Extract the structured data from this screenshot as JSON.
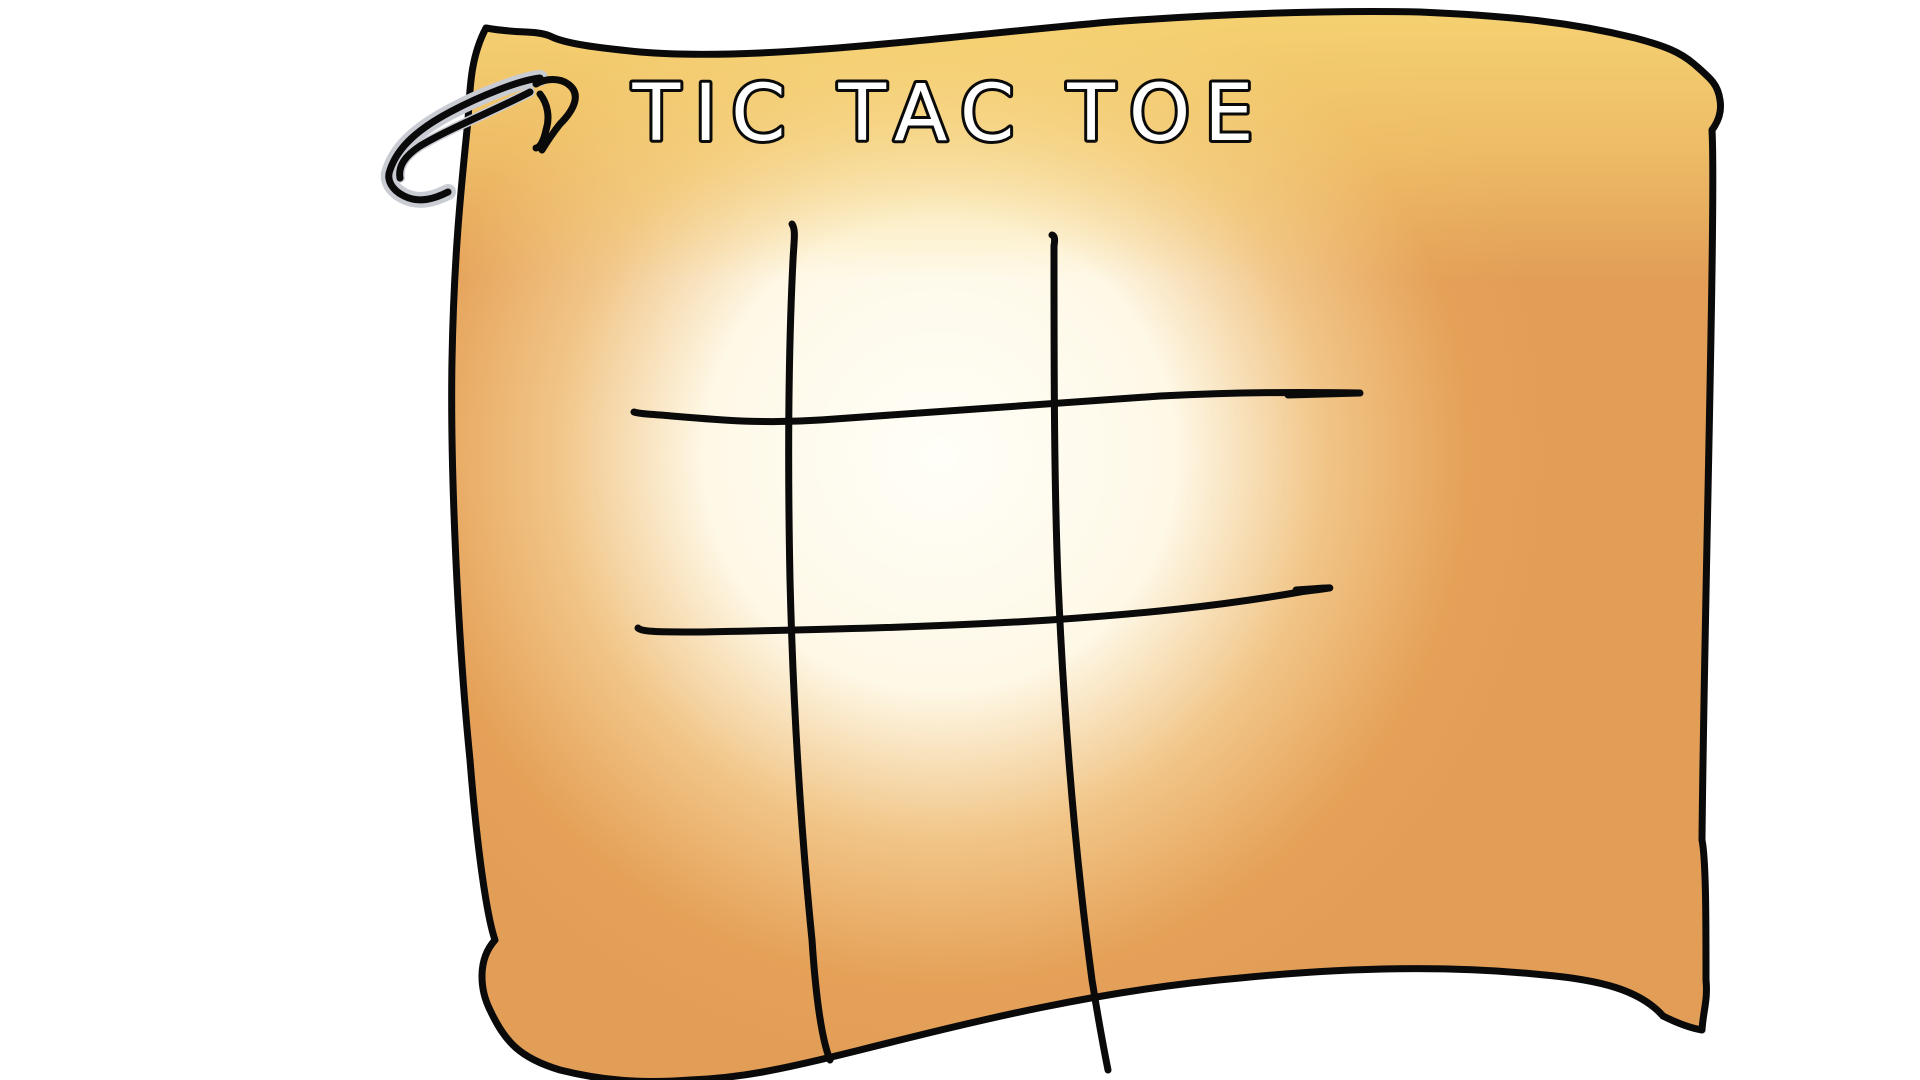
{
  "game": {
    "title": "TIC TAC TOE",
    "cells": [
      "",
      "",
      "",
      "",
      "",
      "",
      "",
      "",
      ""
    ]
  },
  "colors": {
    "paper_edge": "#E5A158",
    "paper_top": "#F6D473",
    "paper_center": "#FFFDF6",
    "ink": "#0A0A0A",
    "ring": "#C9CCD3",
    "background": "#FFFFFF"
  },
  "icons": {
    "pin": "paperclip-icon"
  }
}
